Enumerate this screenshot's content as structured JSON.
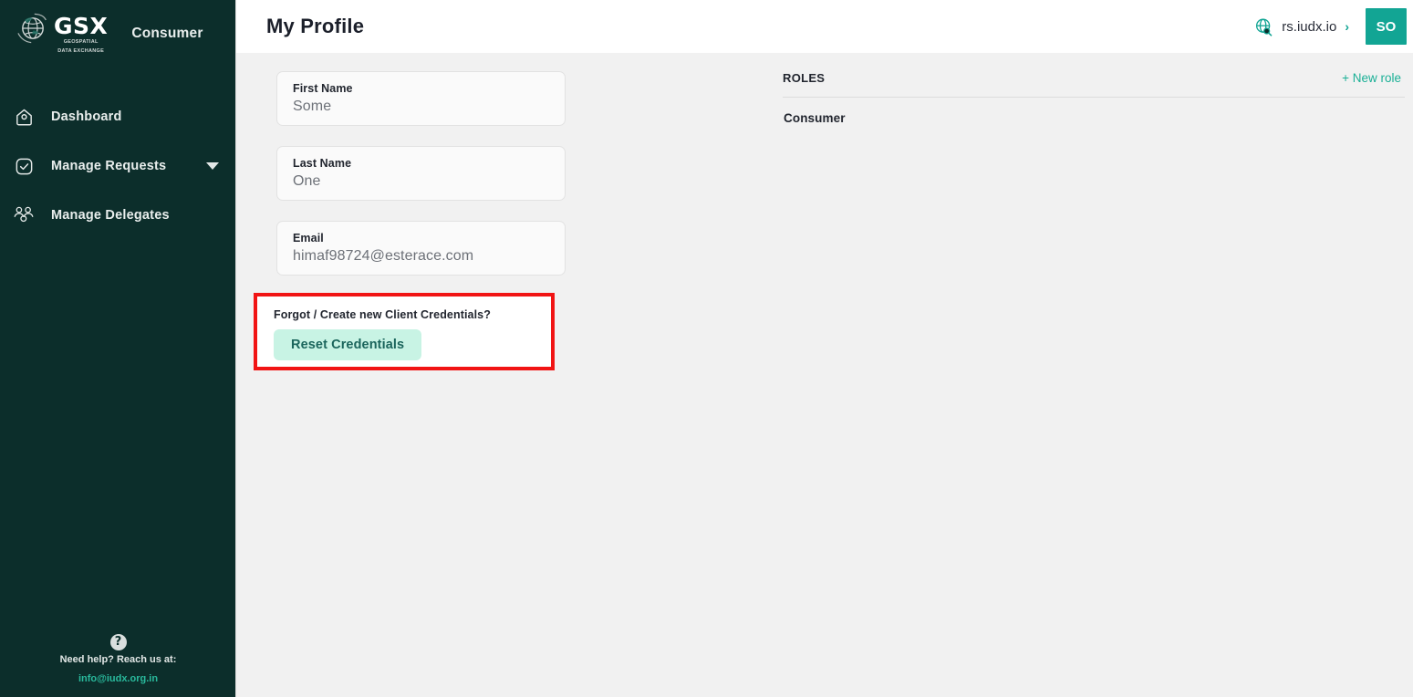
{
  "brand": {
    "logo_icon": "globe-icon",
    "wordmark": "GSX",
    "wordmark_sub_line1": "GEOSPATIAL",
    "wordmark_sub_line2": "DATA EXCHANGE",
    "role_label": "Consumer"
  },
  "sidebar": {
    "items": [
      {
        "label": "Dashboard",
        "icon": "home-icon",
        "has_caret": false
      },
      {
        "label": "Manage Requests",
        "icon": "check-square-icon",
        "has_caret": true
      },
      {
        "label": "Manage Delegates",
        "icon": "people-group-icon",
        "has_caret": false
      }
    ],
    "help": {
      "icon": "question-circle-icon",
      "text": "Need help? Reach us at:",
      "email": "info@iudx.org.in"
    }
  },
  "header": {
    "title": "My Profile",
    "server_icon": "globe-search-icon",
    "server_name": "rs.iudx.io",
    "chevron": "›",
    "avatar_initials": "SO"
  },
  "profile": {
    "fields": [
      {
        "label": "First Name",
        "value": "Some"
      },
      {
        "label": "Last Name",
        "value": "One"
      },
      {
        "label": "Email",
        "value": "himaf98724@esterace.com"
      }
    ],
    "credentials": {
      "question": "Forgot / Create new Client Credentials?",
      "reset_label": "Reset Credentials"
    }
  },
  "roles": {
    "title": "ROLES",
    "new_role_label": "+ New role",
    "items": [
      {
        "name": "Consumer"
      }
    ]
  },
  "colors": {
    "sidebar_bg": "#0c2e2b",
    "accent_teal": "#12a594",
    "link_teal": "#1bb096",
    "mint_button_bg": "#c8f3e4",
    "mint_button_text": "#1b655c",
    "highlight_red": "#f11414",
    "page_bg": "#f1f1f1"
  }
}
